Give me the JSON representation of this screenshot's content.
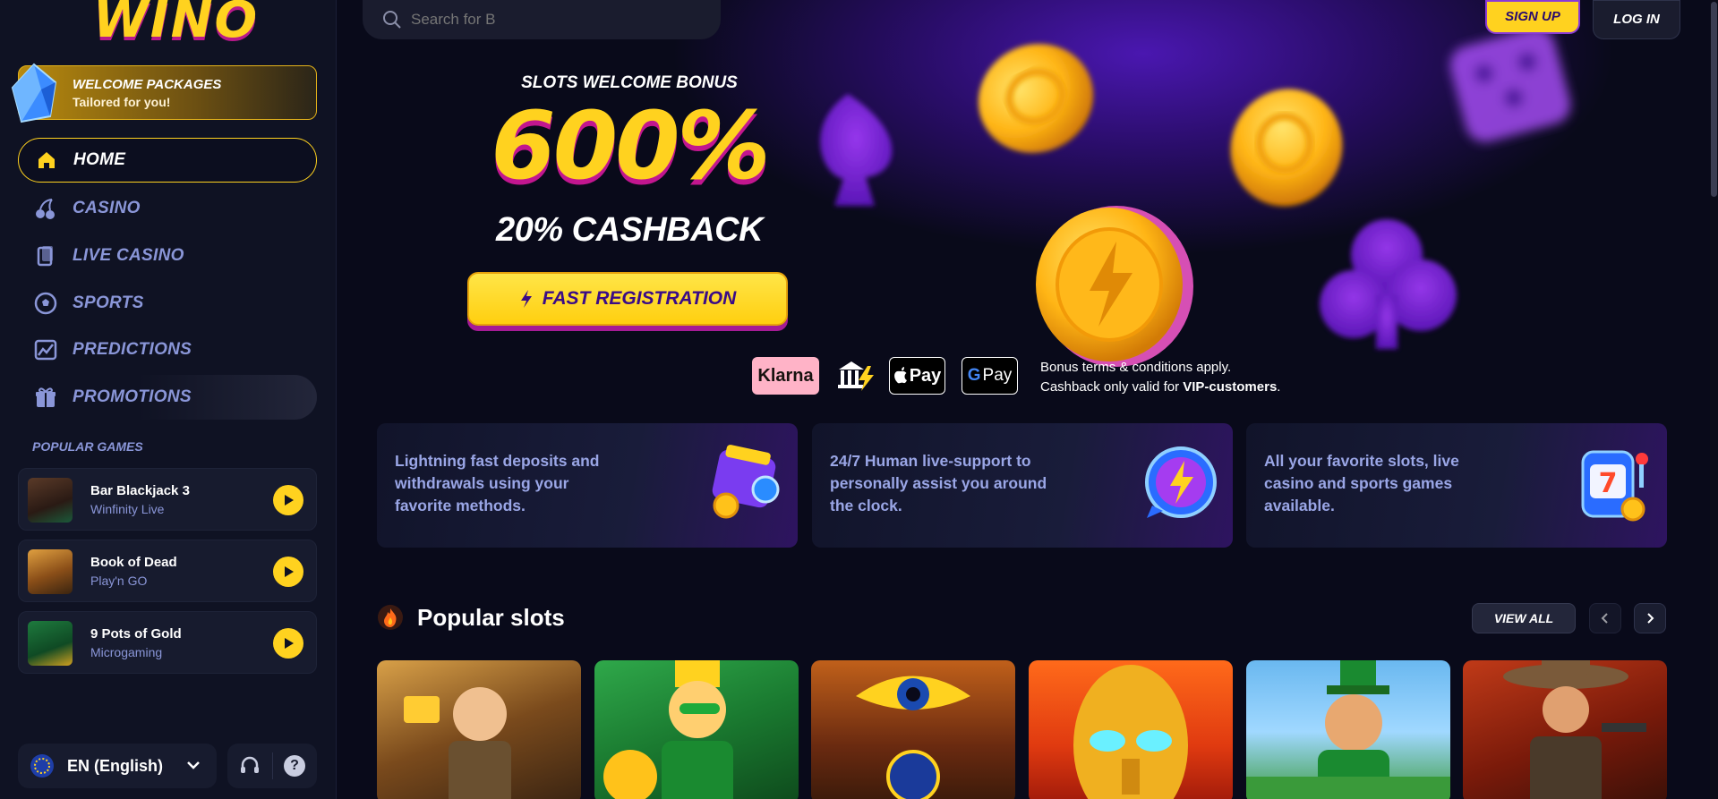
{
  "brand": {
    "logo_text": "WINO",
    "accent": "#ffd21f",
    "secondary": "#8a96d8"
  },
  "sidebar": {
    "welcome": {
      "line1": "WELCOME PACKAGES",
      "line2": "Tailored for you!"
    },
    "nav": [
      {
        "label": "HOME",
        "icon": "home-icon",
        "active": true
      },
      {
        "label": "CASINO",
        "icon": "cherries-icon"
      },
      {
        "label": "LIVE CASINO",
        "icon": "cards-icon"
      },
      {
        "label": "SPORTS",
        "icon": "soccer-ball-icon"
      },
      {
        "label": "PREDICTIONS",
        "icon": "chart-icon"
      },
      {
        "label": "PROMOTIONS",
        "icon": "gift-icon"
      }
    ],
    "popular_title": "POPULAR GAMES",
    "popular_games": [
      {
        "name": "Bar Blackjack 3",
        "provider": "Winfinity Live"
      },
      {
        "name": "Book of Dead",
        "provider": "Play'n GO"
      },
      {
        "name": "9 Pots of Gold",
        "provider": "Microgaming"
      }
    ],
    "language": "EN (English)"
  },
  "header": {
    "search_placeholder": "Search for B",
    "signup": "SIGN UP",
    "login": "LOG IN"
  },
  "hero": {
    "bonus_title": "SLOTS WELCOME BONUS",
    "bonus_value": "600%",
    "cashback": "20% CASHBACK",
    "cta": "FAST REGISTRATION",
    "payments": [
      "Klarna",
      "Bank",
      "Pay",
      "Pay"
    ],
    "terms_line1": "Bonus terms & conditions apply.",
    "terms_line2_prefix": "Cashback only valid for ",
    "terms_line2_bold": "VIP-customers",
    "terms_line2_suffix": "."
  },
  "features": [
    {
      "text": "Lightning fast deposits and withdrawals using your favorite methods.",
      "icon": "wallet-icon"
    },
    {
      "text": "24/7 Human live-support to personally assist you around the clock.",
      "icon": "chat-bolt-icon"
    },
    {
      "text": "All your favorite slots, live casino and sports games available.",
      "icon": "slot-machine-icon"
    }
  ],
  "popular_slots": {
    "title": "Popular slots",
    "view_all": "VIEW ALL",
    "tiles": [
      "book-of-dead-tile",
      "leprechaun-riches-tile",
      "eye-of-horus-tile",
      "golden-mask-tile",
      "leprechaun-tile",
      "cowboy-tile"
    ]
  }
}
